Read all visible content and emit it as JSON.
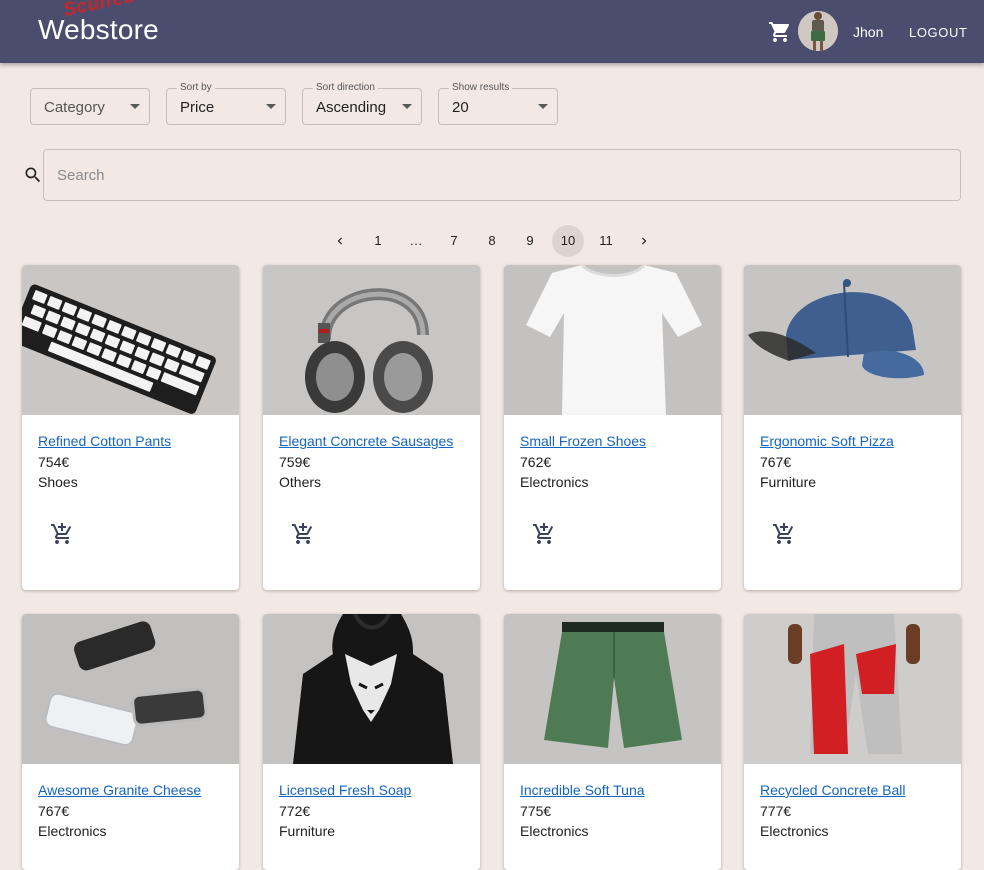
{
  "header": {
    "brand": "Webstore",
    "brand_tag": "Scuffed",
    "username": "Jhon",
    "logout_label": "LOGOUT"
  },
  "filters": {
    "category": {
      "label": "",
      "value": "Category"
    },
    "sort_by": {
      "label": "Sort by",
      "value": "Price"
    },
    "sort_direction": {
      "label": "Sort direction",
      "value": "Ascending"
    },
    "show_results": {
      "label": "Show results",
      "value": "20"
    }
  },
  "search": {
    "placeholder": "Search",
    "value": ""
  },
  "pagination": {
    "pages": [
      "1",
      "…",
      "7",
      "8",
      "9",
      "10",
      "11"
    ],
    "current": "10"
  },
  "products": [
    {
      "name": "Refined Cotton Pants",
      "price": "754€",
      "category": "Shoes",
      "image": "keyboard"
    },
    {
      "name": "Elegant Concrete Sausages",
      "price": "759€",
      "category": "Others",
      "image": "headphones"
    },
    {
      "name": "Small Frozen Shoes",
      "price": "762€",
      "category": "Electronics",
      "image": "tshirt"
    },
    {
      "name": "Ergonomic Soft Pizza",
      "price": "767€",
      "category": "Furniture",
      "image": "cap"
    },
    {
      "name": "Awesome Granite Cheese",
      "price": "767€",
      "category": "Electronics",
      "image": "phones"
    },
    {
      "name": "Licensed Fresh Soap",
      "price": "772€",
      "category": "Furniture",
      "image": "hoodie"
    },
    {
      "name": "Incredible Soft Tuna",
      "price": "775€",
      "category": "Electronics",
      "image": "shorts"
    },
    {
      "name": "Recycled Concrete Ball",
      "price": "777€",
      "category": "Electronics",
      "image": "joggers"
    }
  ],
  "colors": {
    "appbar": "#4a4d6e",
    "background": "#f2e8e4",
    "link": "#1565c0",
    "cart_icon": "#3d4060"
  }
}
